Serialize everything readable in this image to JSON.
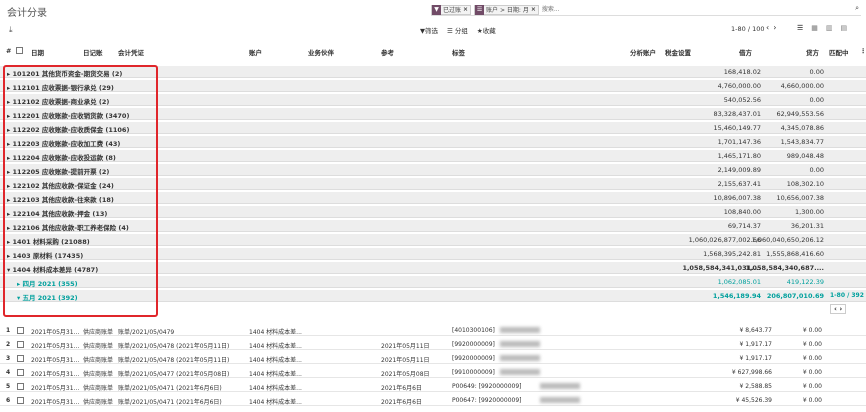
{
  "header": {
    "title": "会计分录",
    "facets": [
      {
        "icon": "filter-icon",
        "text": "已过账"
      },
      {
        "icon": "group-icon",
        "text": "账户 > 日期: 月"
      }
    ],
    "search_placeholder": "搜索..."
  },
  "controls": {
    "filter_label": "▼筛选",
    "group_label": "☰ 分组",
    "favorite_label": "★收藏",
    "pager_text": "1-80 / 100"
  },
  "columns": {
    "date": "日期",
    "journal": "日记账",
    "move": "会计凭证",
    "account": "账户",
    "partner": "业务伙伴",
    "ref": "参考",
    "label": "标签",
    "analytic": "分析账户",
    "tax": "税金设置",
    "debit": "借方",
    "credit": "贷方",
    "match": "匹配中"
  },
  "groups": [
    {
      "label": "▸ 101201 其他货币资金-期货交易 (2)",
      "debit": "168,418.02",
      "credit": "0.00"
    },
    {
      "label": "▸ 112101 应收票据-银行承兑 (29)",
      "debit": "4,760,000.00",
      "credit": "4,660,000.00"
    },
    {
      "label": "▸ 112102 应收票据-商业承兑 (2)",
      "debit": "540,052.56",
      "credit": "0.00"
    },
    {
      "label": "▸ 112201 应收账款-应收销货款 (3470)",
      "debit": "83,328,437.01",
      "credit": "62,949,553.56"
    },
    {
      "label": "▸ 112202 应收账款-应收质保金 (1106)",
      "debit": "15,460,149.77",
      "credit": "4,345,078.86"
    },
    {
      "label": "▸ 112203 应收账款-应收加工费 (43)",
      "debit": "1,701,147.36",
      "credit": "1,543,834.77"
    },
    {
      "label": "▸ 112204 应收账款-应收投运款 (8)",
      "debit": "1,465,171.80",
      "credit": "989,048.48"
    },
    {
      "label": "▸ 112205 应收账款-提前开票 (2)",
      "debit": "2,149,009.89",
      "credit": "0.00"
    },
    {
      "label": "▸ 122102 其他应收款-保证金 (24)",
      "debit": "2,155,637.41",
      "credit": "108,302.10"
    },
    {
      "label": "▸ 122103 其他应收款-往来款 (18)",
      "debit": "10,896,007.38",
      "credit": "10,656,007.38"
    },
    {
      "label": "▸ 122104 其他应收款-押金 (13)",
      "debit": "108,840.00",
      "credit": "1,300.00"
    },
    {
      "label": "▸ 122106 其他应收款-职工养老保险 (4)",
      "debit": "69,714.37",
      "credit": "36,201.31"
    },
    {
      "label": "▸ 1401 材料采购 (21088)",
      "debit": "1,060,026,877,002.66",
      "credit": "1,060,040,650,206.12"
    },
    {
      "label": "▸ 1403 原材料 (17435)",
      "debit": "1,568,395,242.81",
      "credit": "1,555,868,416.60"
    },
    {
      "label": "▾ 1404 材料成本差异 (4787)",
      "debit": "1,058,584,341,031....",
      "credit": "1,058,584,340,687...."
    }
  ],
  "subgroups": [
    {
      "label": "▸ 四月 2021 (355)",
      "debit": "1,062,085.01",
      "credit": "419,122.39"
    },
    {
      "label": "▾ 五月 2021 (392)",
      "debit": "1,546,189.94",
      "credit": "206,807,010.69",
      "pager": "1-80 / 392"
    }
  ],
  "rows": [
    {
      "num": "1",
      "date": "2021年05月31...",
      "journal": "供应商账单",
      "move": "账单/2021/05/0479",
      "account": "1404 材料成本差...",
      "ref": "",
      "label": "[4010300106]",
      "debit": "¥ 8,643.77",
      "credit": "¥ 0.00"
    },
    {
      "num": "2",
      "date": "2021年05月31...",
      "journal": "供应商账单",
      "move": "账单/2021/05/0478 (2021年05月11日)",
      "account": "1404 材料成本差...",
      "ref": "2021年05月11日",
      "label": "[9920000009]",
      "debit": "¥ 1,917.17",
      "credit": "¥ 0.00"
    },
    {
      "num": "3",
      "date": "2021年05月31...",
      "journal": "供应商账单",
      "move": "账单/2021/05/0478 (2021年05月11日)",
      "account": "1404 材料成本差...",
      "ref": "2021年05月11日",
      "label": "[9920000009]",
      "debit": "¥ 1,917.17",
      "credit": "¥ 0.00"
    },
    {
      "num": "4",
      "date": "2021年05月31...",
      "journal": "供应商账单",
      "move": "账单/2021/05/0477 (2021年05月08日)",
      "account": "1404 材料成本差...",
      "ref": "2021年05月08日",
      "label": "[9910000009]",
      "debit": "¥ 627,998.66",
      "credit": "¥ 0.00"
    },
    {
      "num": "5",
      "date": "2021年05月31...",
      "journal": "供应商账单",
      "move": "账单/2021/05/0471 (2021年6月6日)",
      "account": "1404 材料成本差...",
      "ref": "2021年6月6日",
      "label": "P00649: [9920000009]",
      "debit": "¥ 2,588.85",
      "credit": "¥ 0.00"
    },
    {
      "num": "6",
      "date": "2021年05月31...",
      "journal": "供应商账单",
      "move": "账单/2021/05/0471 (2021年6月6日)",
      "account": "1404 材料成本差...",
      "ref": "2021年6月6日",
      "label": "P00647: [9920000009]",
      "debit": "¥ 45,526.39",
      "credit": "¥ 0.00"
    }
  ]
}
